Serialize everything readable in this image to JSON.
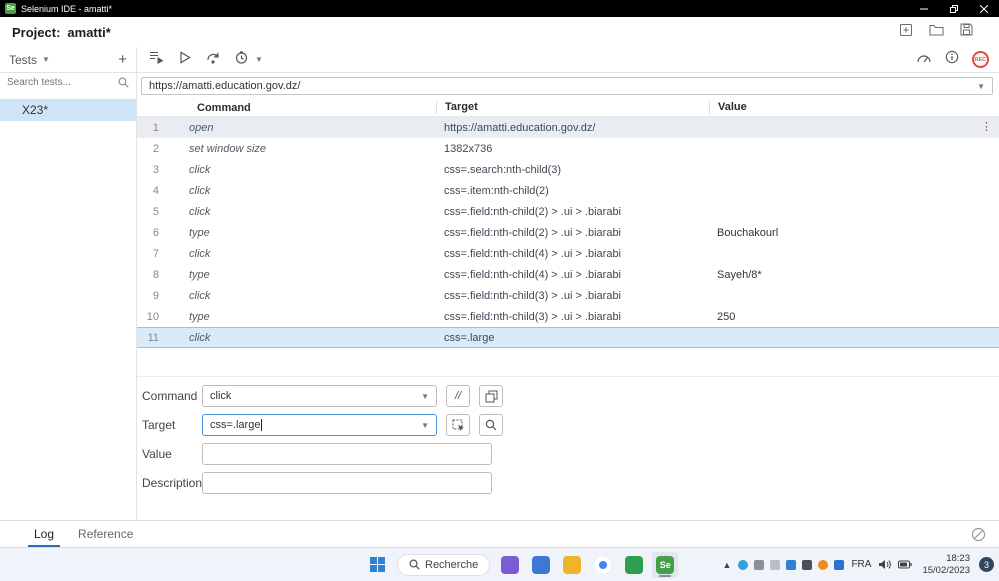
{
  "titlebar": {
    "title": "Selenium IDE - amatti*"
  },
  "project": {
    "label": "Project:",
    "name": "amatti*"
  },
  "toolbar": {
    "tests_label": "Tests"
  },
  "url_bar": {
    "url": "https://amatti.education.gov.dz/"
  },
  "sidebar": {
    "search_placeholder": "Search tests...",
    "tests": [
      {
        "name": "X23*",
        "selected": true
      }
    ]
  },
  "table": {
    "headers": [
      "Command",
      "Target",
      "Value"
    ],
    "rows": [
      {
        "n": "1",
        "command": "open",
        "target": "https://amatti.education.gov.dz/",
        "value": "",
        "state": "executed",
        "menu": true
      },
      {
        "n": "2",
        "command": "set window size",
        "target": "1382x736",
        "value": ""
      },
      {
        "n": "3",
        "command": "click",
        "target": "css=.search:nth-child(3)",
        "value": ""
      },
      {
        "n": "4",
        "command": "click",
        "target": "css=.item:nth-child(2)",
        "value": ""
      },
      {
        "n": "5",
        "command": "click",
        "target": "css=.field:nth-child(2) > .ui > .biarabi",
        "value": ""
      },
      {
        "n": "6",
        "command": "type",
        "target": "css=.field:nth-child(2) > .ui > .biarabi",
        "value": "Bouchakourl"
      },
      {
        "n": "7",
        "command": "click",
        "target": "css=.field:nth-child(4) > .ui > .biarabi",
        "value": ""
      },
      {
        "n": "8",
        "command": "type",
        "target": "css=.field:nth-child(4) > .ui > .biarabi",
        "value": "Sayeh/8*"
      },
      {
        "n": "9",
        "command": "click",
        "target": "css=.field:nth-child(3) > .ui > .biarabi",
        "value": ""
      },
      {
        "n": "10",
        "command": "type",
        "target": "css=.field:nth-child(3) > .ui > .biarabi",
        "value": "250"
      },
      {
        "n": "11",
        "command": "click",
        "target": "css=.large",
        "value": "",
        "state": "selected"
      }
    ]
  },
  "form": {
    "command_label": "Command",
    "command_value": "click",
    "comment_toggle_label": "//",
    "target_label": "Target",
    "target_value": "css=.large",
    "value_label": "Value",
    "description_label": "Description"
  },
  "bottom_tabs": {
    "log_label": "Log",
    "reference_label": "Reference"
  },
  "taskbar": {
    "search_label": "Recherche",
    "app_icons": [
      {
        "name": "pinned-app-icon",
        "color": "#7b5cd6"
      },
      {
        "name": "calculator-app-icon",
        "color": "#3f77d4"
      },
      {
        "name": "file-explorer-icon",
        "color": "#f0b429"
      },
      {
        "name": "chrome-icon",
        "style": "chrome"
      },
      {
        "name": "green-app-icon",
        "color": "#2e9e4f"
      },
      {
        "name": "selenium-app-icon",
        "color": "#43a047",
        "label": "Se",
        "active": true
      }
    ],
    "tray": {
      "icons": [
        {
          "name": "tray-telegram-icon",
          "color": "#2aa3e0",
          "shape": "circle"
        },
        {
          "name": "tray-cloud-icon",
          "color": "#8a8f98"
        },
        {
          "name": "tray-onedrive-icon",
          "color": "#b8bdc6"
        },
        {
          "name": "tray-shield-icon",
          "color": "#2f7fd3"
        },
        {
          "name": "tray-camera-icon",
          "color": "#4a4f57"
        },
        {
          "name": "tray-vlc-icon",
          "color": "#f08c1a",
          "shape": "circle"
        },
        {
          "name": "tray-bluetooth-icon",
          "color": "#2f6fd3"
        }
      ],
      "language": "FRA",
      "time": "18:23",
      "date": "15/02/2023",
      "notification_count": "3"
    }
  },
  "colors": {
    "accent_blue": "#2a6db5",
    "selected_row_bg": "#d9eaf9",
    "selected_row_border": "#93c4e9",
    "selected_test_bg": "#cfe4f7",
    "rec_red": "#e04a3f",
    "selenium_green": "#43a047",
    "titlebar_bg": "#000000",
    "taskbar_bg": "#f0f3f9"
  }
}
